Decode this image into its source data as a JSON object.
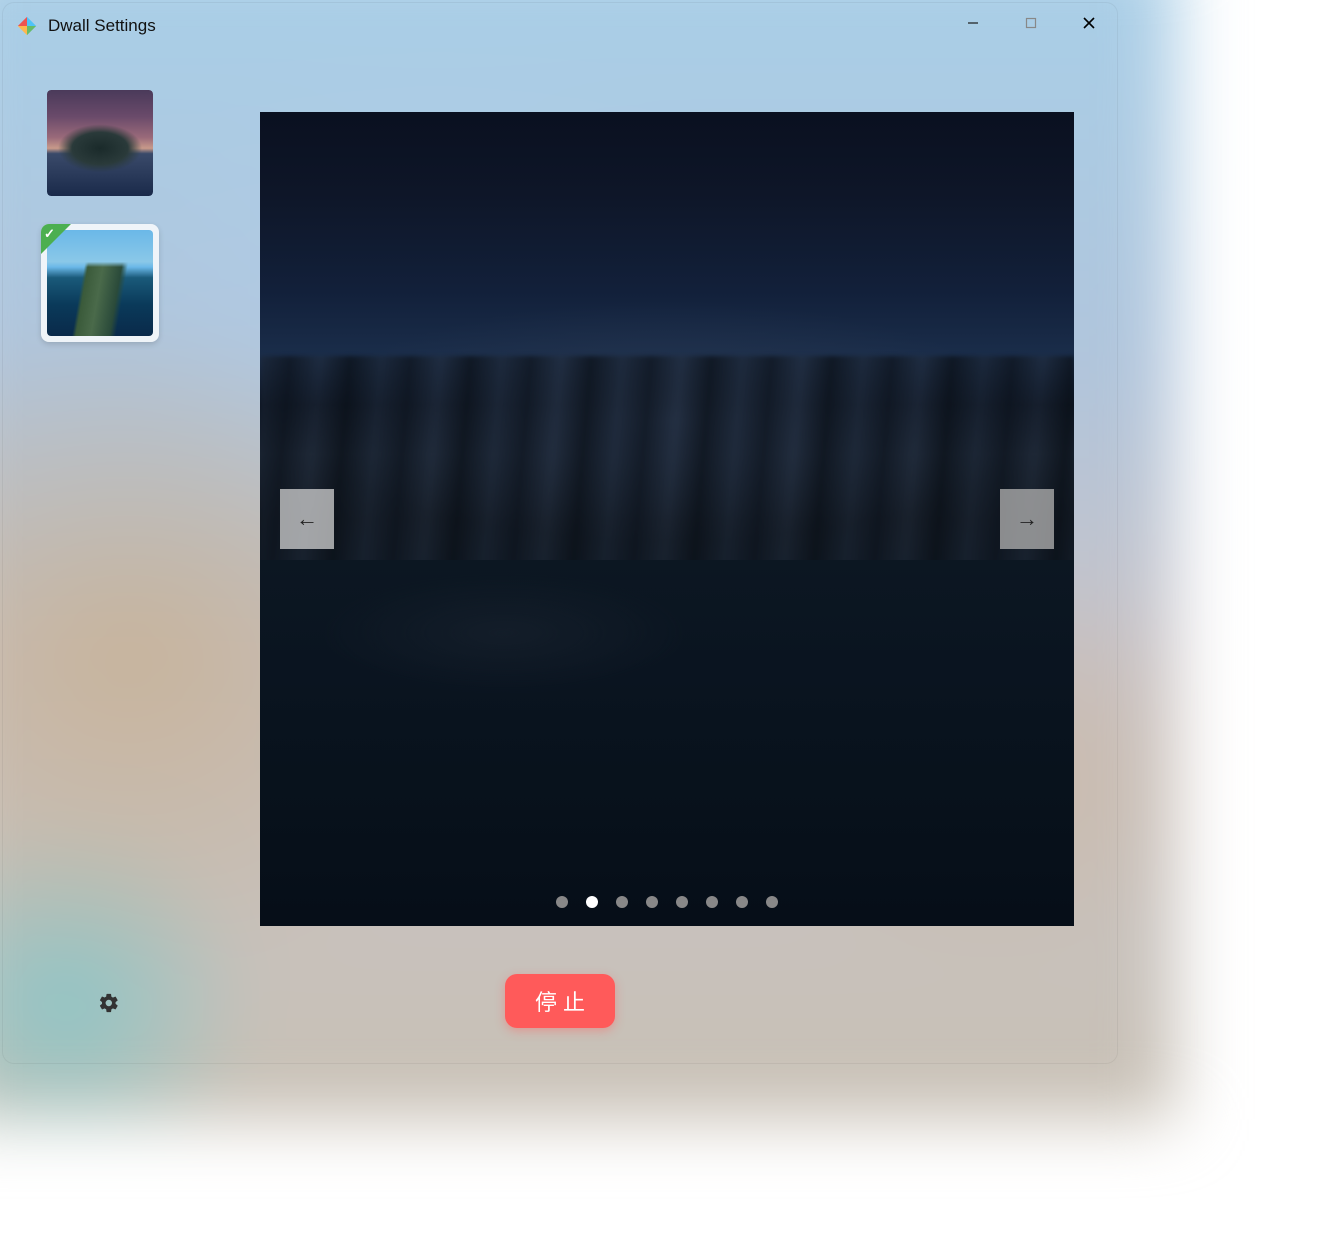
{
  "window": {
    "title": "Dwall Settings",
    "app_icon": "dwall-pinwheel-icon",
    "controls": {
      "minimize": "minimize-icon",
      "maximize": "maximize-icon",
      "close": "close-icon"
    }
  },
  "sidebar": {
    "thumbnails": [
      {
        "id": "island-sunset",
        "selected": false
      },
      {
        "id": "coastal-mountains",
        "selected": true
      }
    ]
  },
  "preview": {
    "current_image": "coastal-mountains-night",
    "nav": {
      "prev": "←",
      "next": "→"
    },
    "pagination": {
      "count": 8,
      "active_index": 1
    }
  },
  "actions": {
    "stop_label": "停止"
  },
  "footer": {
    "settings_icon": "gear-icon"
  }
}
